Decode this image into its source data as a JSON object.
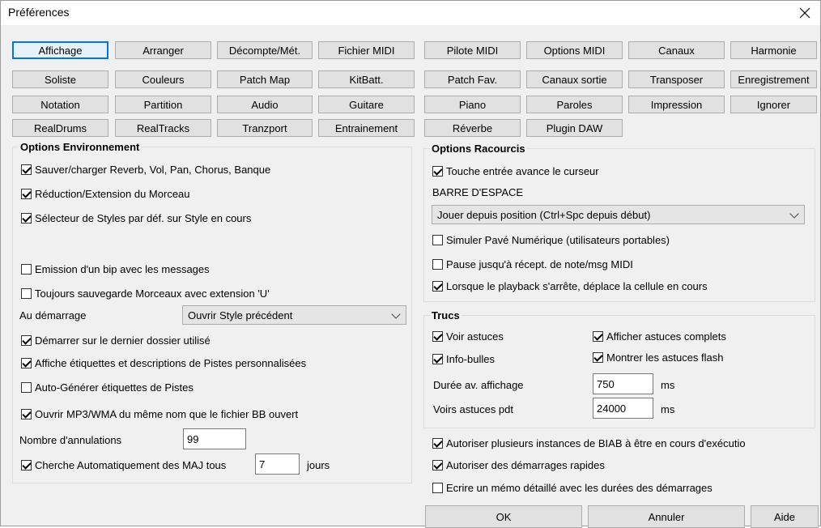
{
  "window": {
    "title": "Préférences"
  },
  "tabs": [
    "Affichage",
    "Arranger",
    "Décompte/Mét.",
    "Fichier MIDI",
    "Pilote MIDI",
    "Options MIDI",
    "Canaux",
    "Harmonie",
    "Soliste",
    "Couleurs",
    "Patch Map",
    "KitBatt.",
    "Patch Fav.",
    "Canaux sortie",
    "Transposer",
    "Enregistrement",
    "Notation",
    "Partition",
    "Audio",
    "Guitare",
    "Piano",
    "Paroles",
    "Impression",
    "Ignorer",
    "RealDrums",
    "RealTracks",
    "Tranzport",
    "Entrainement",
    "Réverbe",
    "Plugin DAW"
  ],
  "env": {
    "title": "Options Environnement",
    "checks": [
      {
        "label": "Sauver/charger Reverb, Vol, Pan, Chorus, Banque",
        "checked": true
      },
      {
        "label": "Réduction/Extension du Morceau",
        "checked": true
      },
      {
        "label": "Sélecteur de Styles par déf. sur Style en cours",
        "checked": true
      },
      {
        "label": "Emission d'un bip avec les messages",
        "checked": false
      },
      {
        "label": "Toujours sauvegarde Morceaux avec extension 'U'",
        "checked": false
      }
    ],
    "startup_label": "Au démarrage",
    "startup_value": "Ouvrir Style précédent",
    "checks2": [
      {
        "label": "Démarrer sur le dernier dossier utilisé",
        "checked": true
      },
      {
        "label": "Affiche étiquettes et descriptions de Pistes personnalisées",
        "checked": true
      },
      {
        "label": "Auto-Générer étiquettes de Pistes",
        "checked": false
      },
      {
        "label": "Ouvrir MP3/WMA du même nom que le fichier BB ouvert",
        "checked": true
      }
    ],
    "undo_label": "Nombre d'annulations",
    "undo_value": "99",
    "update_label": "Cherche Automatiquement des MAJ tous",
    "update_checked": true,
    "update_value": "7",
    "update_unit": "jours"
  },
  "shortcuts": {
    "title": "Options Racourcis",
    "enter_label": "Touche entrée avance le curseur",
    "enter_checked": true,
    "space_label": "BARRE D'ESPACE",
    "space_value": "Jouer depuis position (Ctrl+Spc depuis début)",
    "checks": [
      {
        "label": "Simuler Pavé Numérique (utilisateurs portables)",
        "checked": false
      },
      {
        "label": "Pause jusqu'à récept. de note/msg MIDI",
        "checked": false
      },
      {
        "label": "Lorsque le playback s'arrête, déplace la cellule en cours",
        "checked": true
      }
    ]
  },
  "tips": {
    "title": "Trucs",
    "voir": {
      "label": "Voir astuces",
      "checked": true
    },
    "complets": {
      "label": "Afficher astuces complets",
      "checked": true
    },
    "bulles": {
      "label": "Info-bulles",
      "checked": true
    },
    "flash": {
      "label": "Montrer les astuces flash",
      "checked": true
    },
    "delay_label": "Durée av. affichage",
    "delay_value": "750",
    "duration_label": "Voirs astuces pdt",
    "duration_value": "24000",
    "unit": "ms"
  },
  "bottom": {
    "checks": [
      {
        "label": "Autoriser plusieurs instances de BIAB à être en cours d'exécutio",
        "checked": true
      },
      {
        "label": "Autoriser des démarrages rapides",
        "checked": true
      },
      {
        "label": "Ecrire un mémo détaillé avec les durées des démarrages",
        "checked": false
      }
    ]
  },
  "buttons": {
    "ok": "OK",
    "cancel": "Annuler",
    "help": "Aide"
  }
}
